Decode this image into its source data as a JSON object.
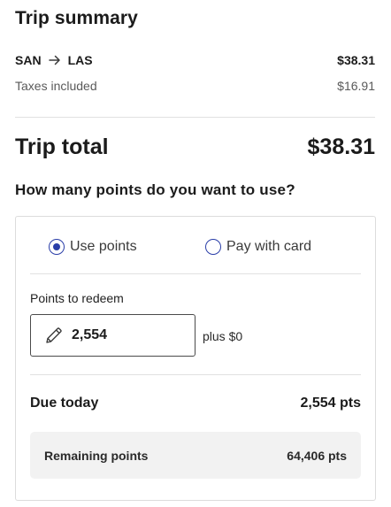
{
  "summary": {
    "title": "Trip summary",
    "route": {
      "origin": "SAN",
      "destination": "LAS",
      "arrow_icon": "arrow-right-icon",
      "price": "$38.31"
    },
    "taxes": {
      "label": "Taxes included",
      "amount": "$16.91"
    },
    "total": {
      "label": "Trip total",
      "amount": "$38.31"
    }
  },
  "points": {
    "question": "How many points do you want to use?",
    "options": [
      {
        "label": "Use points",
        "selected": true
      },
      {
        "label": "Pay with card",
        "selected": false
      }
    ],
    "redeem_label": "Points to redeem",
    "redeem_value": "2,554",
    "edit_icon": "pencil-icon",
    "plus_text": "plus $0",
    "due": {
      "label": "Due today",
      "value": "2,554 pts"
    },
    "remaining": {
      "label": "Remaining points",
      "value": "64,406 pts"
    }
  },
  "colors": {
    "accent": "#2a3ea8",
    "panel_bg": "#f2f2f2",
    "divider": "#e1e1e1"
  }
}
